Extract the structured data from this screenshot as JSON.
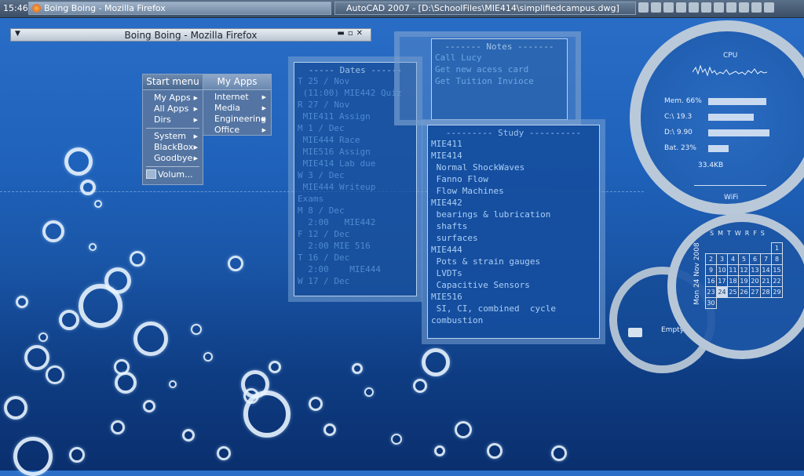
{
  "taskbar": {
    "clock": "15:46",
    "tasks": [
      {
        "label": "Boing Boing - Mozilla Firefox"
      },
      {
        "label": "AutoCAD 2007 - [D:\\SchoolFiles\\MIE414\\simplifiedcampus.dwg]"
      }
    ],
    "tray_icons": [
      "display-icon",
      "drive-icon",
      "network-icon",
      "settings-icon",
      "drive-icon",
      "network-icon",
      "signal-icon",
      "monitor-icon",
      "volume-icon",
      "speaker-icon",
      "power-icon"
    ]
  },
  "window": {
    "title": "Boing Boing - Mozilla Firefox"
  },
  "start_menu": {
    "header": "Start menu",
    "items": [
      {
        "label": "My Apps",
        "arrow": "▶"
      },
      {
        "label": "All Apps",
        "arrow": "▶"
      },
      {
        "label": "Dirs",
        "arrow": "▶"
      },
      {
        "label": "System",
        "arrow": "▶"
      },
      {
        "label": "BlackBox",
        "arrow": "▶"
      },
      {
        "label": "Goodbye",
        "arrow": "▶"
      },
      {
        "label": "Volum..."
      }
    ]
  },
  "my_apps": {
    "header": "My Apps",
    "items": [
      {
        "label": "Internet",
        "arrow": "▶"
      },
      {
        "label": "Media",
        "arrow": "▶"
      },
      {
        "label": "Engineering",
        "arrow": "▶"
      },
      {
        "label": "Office",
        "arrow": "▶"
      }
    ]
  },
  "dates": {
    "title": "----- Dates ------",
    "lines": [
      "T 25 / Nov",
      " (11:00) MIE442 Quiz",
      "R 27 / Nov",
      " MIE411 Assign",
      "M 1 / Dec",
      " MIE444 Race",
      " MIE516 Assign",
      " MIE414 Lab due",
      "W 3 / Dec",
      " MIE444 Writeup",
      "Exams",
      "M 8 / Dec",
      "  2:00   MIE442",
      "F 12 / Dec",
      "  2:00 MIE 516",
      "T 16 / Dec",
      "  2:00    MIE444",
      "W 17 / Dec"
    ]
  },
  "notes": {
    "title": "------- Notes -------",
    "lines": [
      "Call Lucy",
      "Get new acess card",
      "Get Tuition Invioce"
    ]
  },
  "study": {
    "title": "--------- Study ----------",
    "lines": [
      "MIE411",
      "MIE414",
      " Normal ShockWaves",
      " Fanno Flow",
      " Flow Machines",
      "MIE442",
      " bearings & lubrication",
      " shafts",
      " surfaces",
      "MIE444",
      " Pots & strain gauges",
      " LVDTs",
      " Capacitive Sensors",
      "MIE516",
      " SI, CI, combined  cycle",
      "combustion"
    ]
  },
  "sysmon": {
    "cpu_label": "CPU",
    "stats": [
      {
        "label": "Mem. 66%",
        "value": 0.66
      },
      {
        "label": "C:\\   19.3",
        "value": 0.52
      },
      {
        "label": "D:\\  9.90",
        "value": 0.7
      },
      {
        "label": "Bat. 23%",
        "value": 0.23
      }
    ],
    "net": "33.4KB",
    "wifi": "WiFi"
  },
  "calendar": {
    "date_label": "Mon 24 Nov 2008",
    "weekdays": "SMTWRFS",
    "weeks": [
      [
        "",
        "",
        "",
        "",
        "",
        "",
        "1"
      ],
      [
        "2",
        "3",
        "4",
        "5",
        "6",
        "7",
        "8"
      ],
      [
        "9",
        "10",
        "11",
        "12",
        "13",
        "14",
        "15"
      ],
      [
        "16",
        "17",
        "18",
        "19",
        "20",
        "21",
        "22"
      ],
      [
        "23",
        "24",
        "25",
        "26",
        "27",
        "28",
        "29"
      ],
      [
        "30",
        "",
        "",
        "",
        "",
        "",
        ""
      ]
    ],
    "today": "24"
  },
  "trash": {
    "label": "Empty"
  }
}
